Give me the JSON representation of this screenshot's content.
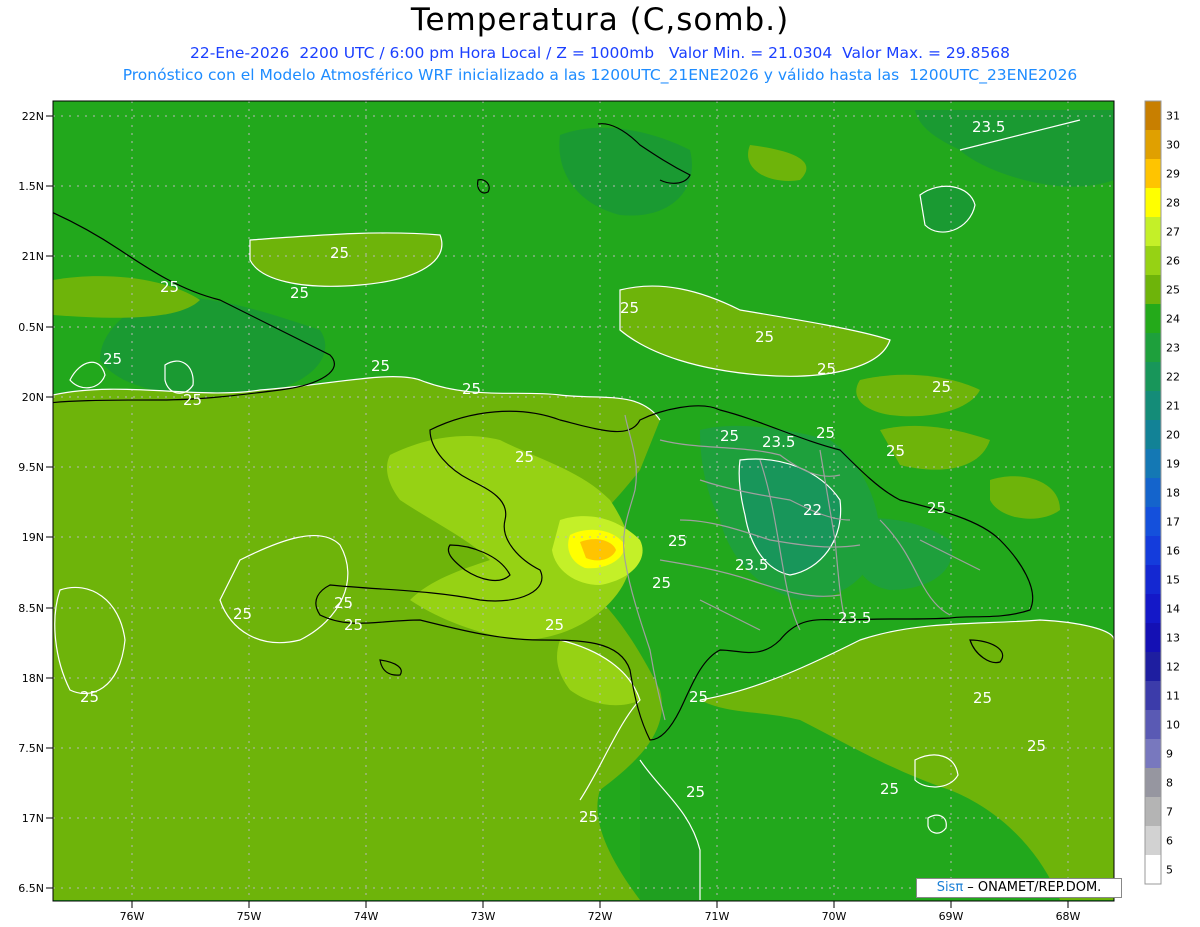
{
  "title": "Temperatura (C,somb.)",
  "subtitle_line1": "22-Ene-2026  2200 UTC / 6:00 pm Hora Local / Z = 1000mb   Valor Min. = 21.0304  Valor Max. = 29.8568",
  "subtitle_line2": "Pronóstico con el Modelo Atmosférico WRF inicializado a las 1200UTC_21ENE2026 y válido hasta las  1200UTC_23ENE2026",
  "credit": {
    "brand": "Sisπ",
    "text": " – ONAMET/REP.DOM."
  },
  "map": {
    "lat_ticks": [
      "22N",
      "1.5N",
      "21N",
      "0.5N",
      "20N",
      "9.5N",
      "19N",
      "8.5N",
      "18N",
      "7.5N",
      "17N",
      "6.5N"
    ],
    "lon_ticks": [
      "76W",
      "75W",
      "74W",
      "73W",
      "72W",
      "71W",
      "70W",
      "69W",
      "68W"
    ],
    "contour_labels": [
      "25",
      "25",
      "25",
      "25",
      "25",
      "25",
      "25",
      "25",
      "25",
      "25",
      "25",
      "25",
      "25",
      "25",
      "25",
      "25",
      "25",
      "25",
      "25",
      "25",
      "25",
      "25",
      "25",
      "25",
      "25",
      "23.5",
      "23.5",
      "23.5",
      "23.5",
      "22"
    ],
    "ocean_value_c": 24,
    "background_color": "#22a81c"
  },
  "colorbar": {
    "levels": [
      "31",
      "30",
      "29",
      "28",
      "27",
      "26",
      "25",
      "24",
      "23",
      "22",
      "21",
      "20",
      "19",
      "18",
      "17",
      "16",
      "15",
      "14",
      "13",
      "12",
      "11",
      "10",
      "9",
      "8",
      "7",
      "6",
      "5"
    ],
    "colors": [
      "#c87f00",
      "#e0a000",
      "#ffc400",
      "#ffff00",
      "#c4f028",
      "#96d214",
      "#6eb40a",
      "#24aa1a",
      "#1ea03c",
      "#18965a",
      "#148c78",
      "#128296",
      "#1478b4",
      "#1464cc",
      "#1450dc",
      "#143cdc",
      "#1428d2",
      "#1418c8",
      "#1410b4",
      "#1e1ea0",
      "#3c3caa",
      "#5a5ab4",
      "#7878be",
      "#9696a0",
      "#b4b4b4",
      "#d2d2d2",
      "#ffffff"
    ]
  }
}
